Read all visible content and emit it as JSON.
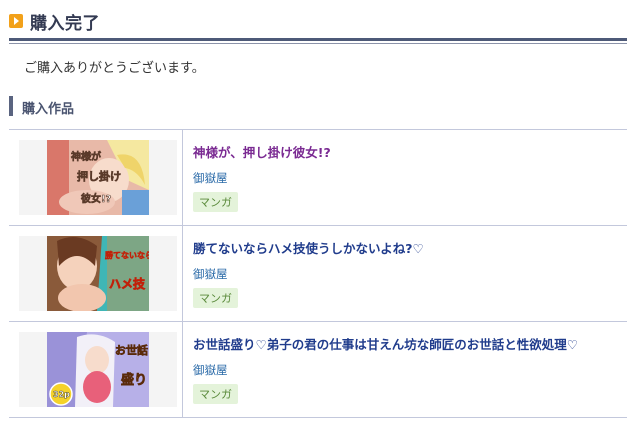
{
  "header": {
    "title": "購入完了"
  },
  "message": "ご購入ありがとうございます。",
  "section": {
    "title": "購入作品"
  },
  "items": [
    {
      "title": "神様が、押し掛け彼女!?",
      "circle": "御嶽屋",
      "category": "マンガ",
      "visited": true,
      "cover_text": [
        "神様が",
        "押し掛け",
        "彼女!?"
      ]
    },
    {
      "title": "勝てないならハメ技使うしかないよね?♡",
      "circle": "御嶽屋",
      "category": "マンガ",
      "visited": false,
      "cover_text": [
        "勝てないなら",
        "ハメ技"
      ]
    },
    {
      "title": "お世話盛り♡弟子の君の仕事は甘えん坊な師匠のお世話と性欲処理♡",
      "circle": "御嶽屋",
      "category": "マンガ",
      "visited": false,
      "cover_text": [
        "お世話",
        "盛り",
        "32p"
      ]
    }
  ],
  "colors": {
    "header_accent": "#f2a11a",
    "header_rule": "#4e5a78",
    "link": "#203c8c",
    "visited_link": "#7a2a92",
    "badge_bg": "#e4f3da"
  }
}
